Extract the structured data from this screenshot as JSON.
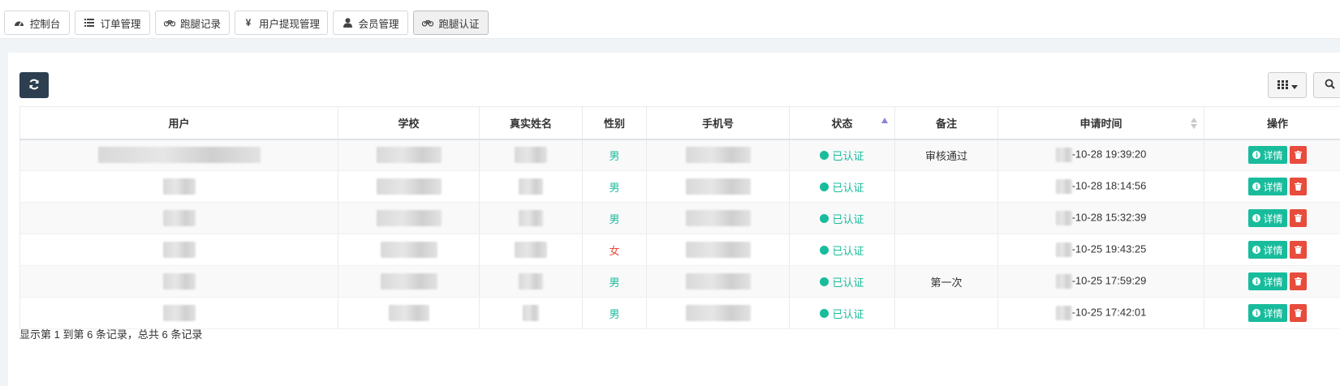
{
  "tabs": [
    {
      "label": "控制台",
      "icon": "dashboard-icon",
      "active": false
    },
    {
      "label": "订单管理",
      "icon": "list-icon",
      "active": false
    },
    {
      "label": "跑腿记录",
      "icon": "bicycle-icon",
      "active": false
    },
    {
      "label": "用户提现管理",
      "icon": "yen-icon",
      "active": false
    },
    {
      "label": "会员管理",
      "icon": "user-icon",
      "active": false
    },
    {
      "label": "跑腿认证",
      "icon": "bicycle-icon",
      "active": true
    }
  ],
  "toolbar": {
    "refresh_icon": "refresh-icon",
    "columns_icon": "grid-icon",
    "search_icon": "search-icon"
  },
  "table": {
    "headers": [
      "用户",
      "学校",
      "真实姓名",
      "性别",
      "手机号",
      "状态",
      "备注",
      "申请时间",
      "操作"
    ],
    "rows": [
      {
        "user": "",
        "school": "",
        "realname": "",
        "gender": "男",
        "phone": "",
        "status": "已认证",
        "remark": "审核通过",
        "time": "-10-28 19:39:20"
      },
      {
        "user": "",
        "school": "",
        "realname": "",
        "gender": "男",
        "phone": "",
        "status": "已认证",
        "remark": "",
        "time": "-10-28 18:14:56"
      },
      {
        "user": "",
        "school": "",
        "realname": "",
        "gender": "男",
        "phone": "",
        "status": "已认证",
        "remark": "",
        "time": "-10-28 15:32:39"
      },
      {
        "user": "",
        "school": "",
        "realname": "",
        "gender": "女",
        "phone": "",
        "status": "已认证",
        "remark": "",
        "time": "-10-25 19:43:25"
      },
      {
        "user": "",
        "school": "",
        "realname": "",
        "gender": "男",
        "phone": "",
        "status": "已认证",
        "remark": "第一次",
        "time": "-10-25 17:59:29"
      },
      {
        "user": "",
        "school": "",
        "realname": "",
        "gender": "男",
        "phone": "",
        "status": "已认证",
        "remark": "",
        "time": "-10-25 17:42:01"
      }
    ],
    "action_detail_label": "详情"
  },
  "footer": {
    "info": "显示第 1 到第 6 条记录，总共 6 条记录"
  },
  "colors": {
    "primary": "#2c3e50",
    "success": "#18bc9c",
    "danger": "#e74c3c"
  }
}
